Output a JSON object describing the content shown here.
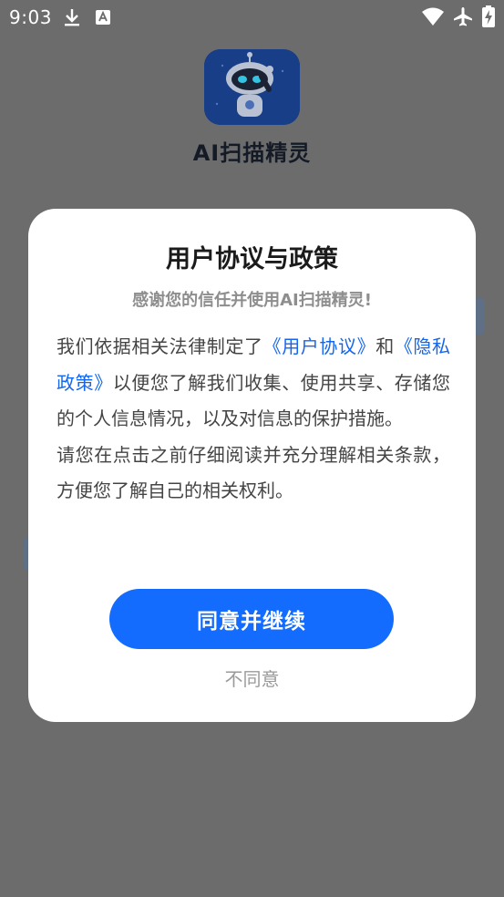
{
  "status_bar": {
    "time": "9:03",
    "icons": [
      "download-icon",
      "keyboard-icon",
      "wifi-icon",
      "airplane-mode-icon",
      "battery-charging-icon"
    ]
  },
  "app": {
    "name": "AI扫描精灵",
    "logo_icon": "robot-logo-icon"
  },
  "dialog": {
    "title": "用户协议与政策",
    "subtitle": "感谢您的信任并使用AI扫描精灵!",
    "body": {
      "text1": "我们依据相关法律制定了",
      "link1": "《用户协议》",
      "text2": "和",
      "link2": "《隐私政策》",
      "text3": "以便您了解我们收集、使用共享、存储您的个人信息情况，以及对信息的保护措施。",
      "paragraph2": "请您在点击之前仔细阅读并充分理解相关条款，方便您了解自己的相关权利。"
    },
    "agree_label": "同意并继续",
    "disagree_label": "不同意"
  },
  "colors": {
    "primary": "#136cfe",
    "link": "#1466f0",
    "overlay_background": "#6c6c6c"
  }
}
